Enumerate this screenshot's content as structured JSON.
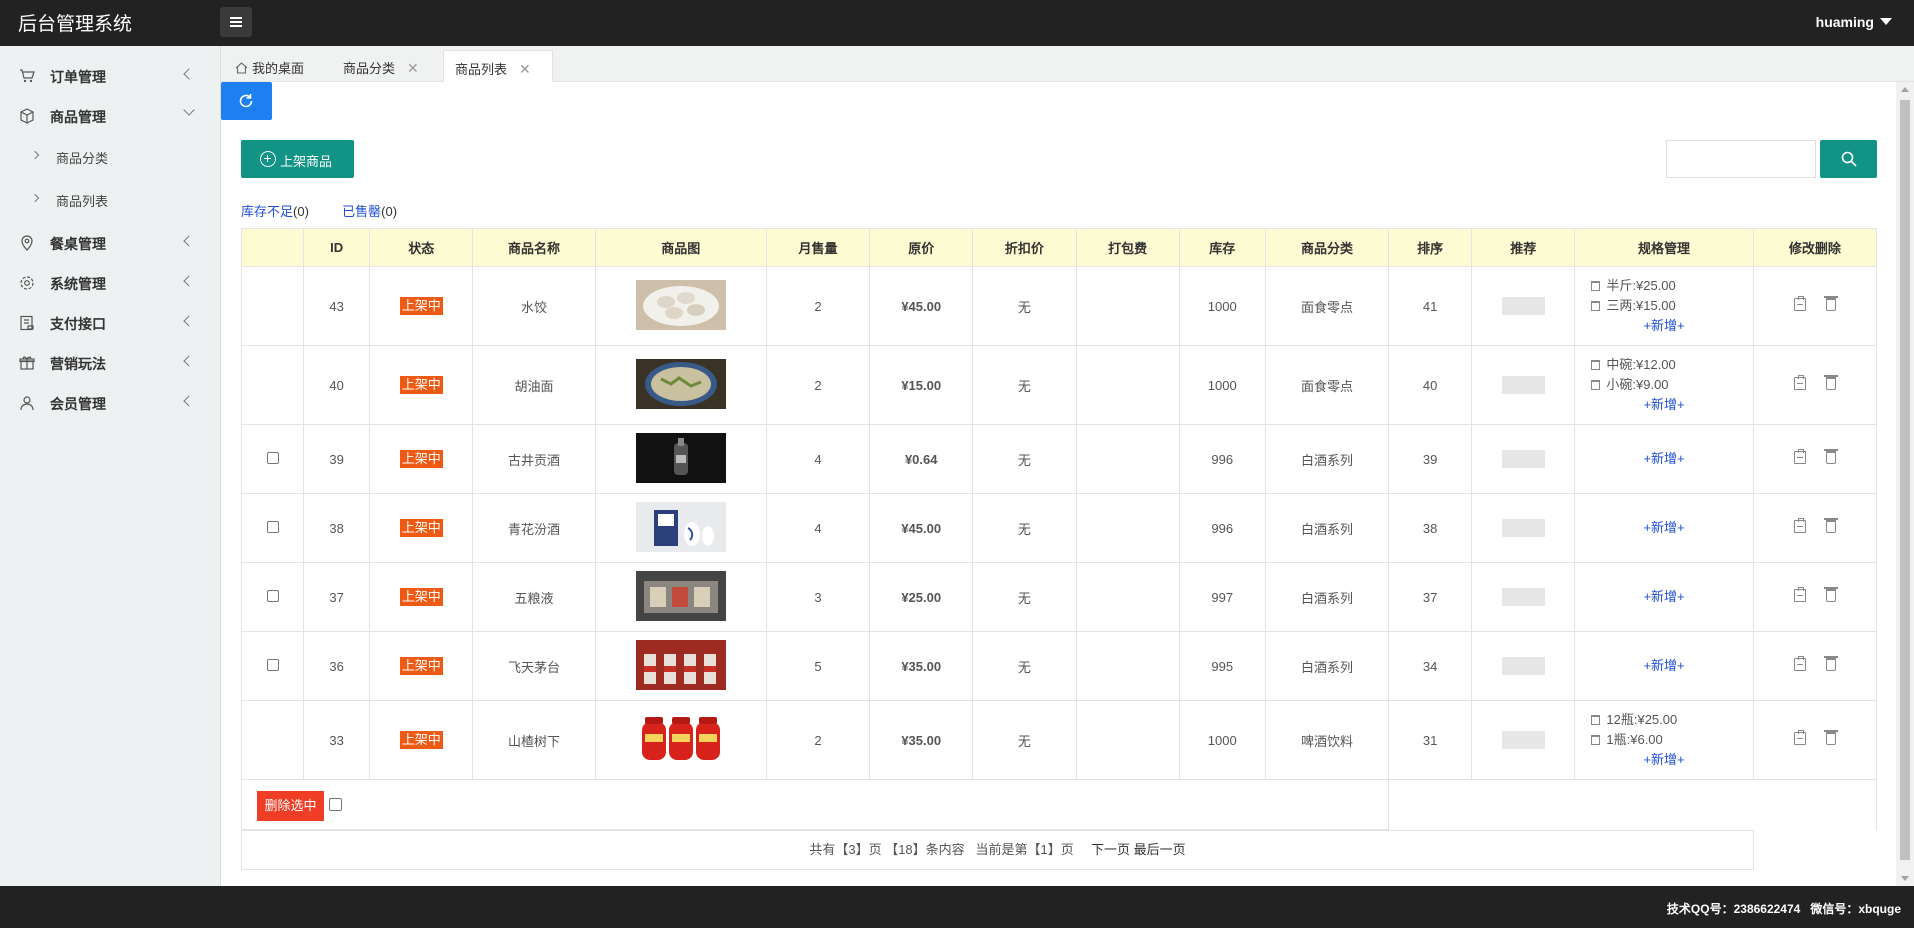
{
  "header": {
    "brand": "后台管理系统",
    "user": "huaming"
  },
  "sidebar": {
    "items": [
      {
        "label": "订单管理",
        "icon": "cart-icon"
      },
      {
        "label": "商品管理",
        "icon": "box-icon",
        "expanded": true
      },
      {
        "label": "餐桌管理",
        "icon": "location-icon"
      },
      {
        "label": "系统管理",
        "icon": "gear-icon"
      },
      {
        "label": "支付接口",
        "icon": "payment-icon"
      },
      {
        "label": "营销玩法",
        "icon": "gift-icon"
      },
      {
        "label": "会员管理",
        "icon": "user-icon"
      }
    ],
    "subitems": [
      {
        "label": "商品分类"
      },
      {
        "label": "商品列表"
      }
    ]
  },
  "tabs": [
    {
      "label": "我的桌面",
      "icon": "home-icon"
    },
    {
      "label": "商品分类",
      "close": "✕"
    },
    {
      "label": "商品列表",
      "close": "✕",
      "active": true
    }
  ],
  "toolbar": {
    "add_label": "上架商品",
    "search_placeholder": ""
  },
  "filters": {
    "low_stock_label": "库存不足",
    "low_stock_count": "(0)",
    "sold_out_label": "已售罄",
    "sold_out_count": "(0)"
  },
  "table": {
    "headers": [
      "",
      "ID",
      "状态",
      "商品名称",
      "商品图",
      "月售量",
      "原价",
      "折扣价",
      "打包费",
      "库存",
      "商品分类",
      "排序",
      "推荐",
      "规格管理",
      "修改删除"
    ],
    "rows": [
      {
        "checkbox": false,
        "id": "43",
        "status": "上架中",
        "name": "水饺",
        "image": "dumplings-image",
        "monthly_sales": "2",
        "price": "¥45.00",
        "discount": "无",
        "packing": "",
        "stock": "1000",
        "category": "面食零点",
        "sort": "41",
        "recommend": "未推荐",
        "specs": [
          "半斤:¥25.00",
          "三两:¥15.00"
        ],
        "add_spec": "+新增+"
      },
      {
        "checkbox": false,
        "id": "40",
        "status": "上架中",
        "name": "胡油面",
        "image": "noodles-image",
        "monthly_sales": "2",
        "price": "¥15.00",
        "discount": "无",
        "packing": "",
        "stock": "1000",
        "category": "面食零点",
        "sort": "40",
        "recommend": "未推荐",
        "specs": [
          "中碗:¥12.00",
          "小碗:¥9.00"
        ],
        "add_spec": "+新增+"
      },
      {
        "checkbox": true,
        "id": "39",
        "status": "上架中",
        "name": "古井贡酒",
        "image": "liquor-bottle-image",
        "monthly_sales": "4",
        "price": "¥0.64",
        "discount": "无",
        "packing": "",
        "stock": "996",
        "category": "白酒系列",
        "sort": "39",
        "recommend": "未推荐",
        "specs": [],
        "add_spec": "+新增+"
      },
      {
        "checkbox": true,
        "id": "38",
        "status": "上架中",
        "name": "青花汾酒",
        "image": "porcelain-liquor-image",
        "monthly_sales": "4",
        "price": "¥45.00",
        "discount": "无",
        "packing": "",
        "stock": "996",
        "category": "白酒系列",
        "sort": "38",
        "recommend": "未推荐",
        "specs": [],
        "add_spec": "+新增+"
      },
      {
        "checkbox": true,
        "id": "37",
        "status": "上架中",
        "name": "五粮液",
        "image": "liquor-box-image",
        "monthly_sales": "3",
        "price": "¥25.00",
        "discount": "无",
        "packing": "",
        "stock": "997",
        "category": "白酒系列",
        "sort": "37",
        "recommend": "未推荐",
        "specs": [],
        "add_spec": "+新增+"
      },
      {
        "checkbox": true,
        "id": "36",
        "status": "上架中",
        "name": "飞天茅台",
        "image": "red-bottles-image",
        "monthly_sales": "5",
        "price": "¥35.00",
        "discount": "无",
        "packing": "",
        "stock": "995",
        "category": "白酒系列",
        "sort": "34",
        "recommend": "未推荐",
        "specs": [],
        "add_spec": "+新增+"
      },
      {
        "checkbox": false,
        "id": "33",
        "status": "上架中",
        "name": "山楂树下",
        "image": "juice-bottles-image",
        "monthly_sales": "2",
        "price": "¥35.00",
        "discount": "无",
        "packing": "",
        "stock": "1000",
        "category": "啤酒饮料",
        "sort": "31",
        "recommend": "未推荐",
        "specs": [
          "12瓶:¥25.00",
          "1瓶:¥6.00"
        ],
        "add_spec": "+新增+"
      }
    ]
  },
  "bulk": {
    "delete_label": "删除选中"
  },
  "pager": {
    "summary": "共有【3】页 【18】条内容   当前是第【1】页",
    "next": "下一页",
    "last": "最后一页"
  },
  "footer": {
    "text": "技术QQ号：2386622474   微信号：xbquge"
  },
  "colors": {
    "header_bg": "#222222",
    "accent_green": "#119486",
    "accent_blue": "#1e7ff0",
    "status_orange": "#ee5a14",
    "delete_red": "#f03d25",
    "table_head_bg": "#fdfbd1"
  }
}
